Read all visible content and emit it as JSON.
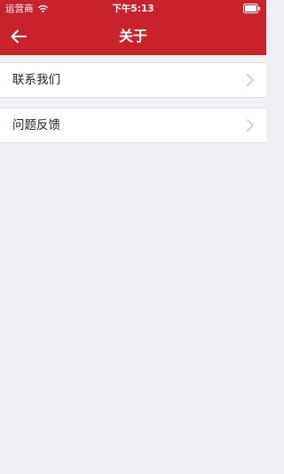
{
  "status_bar": {
    "carrier": "运营商",
    "time": "下午5:13",
    "wifi_icon": "wifi-icon",
    "battery_icon": "battery-icon"
  },
  "nav": {
    "title": "关于",
    "back_icon": "arrow-left-icon",
    "background_color": "#c8232c"
  },
  "menu": {
    "items": [
      {
        "label": "联系我们",
        "icon": "chevron-right-icon"
      },
      {
        "label": "问题反馈",
        "icon": "chevron-right-icon"
      }
    ]
  },
  "colors": {
    "accent": "#c8232c",
    "page_background": "#efeff4",
    "row_background": "#ffffff"
  }
}
